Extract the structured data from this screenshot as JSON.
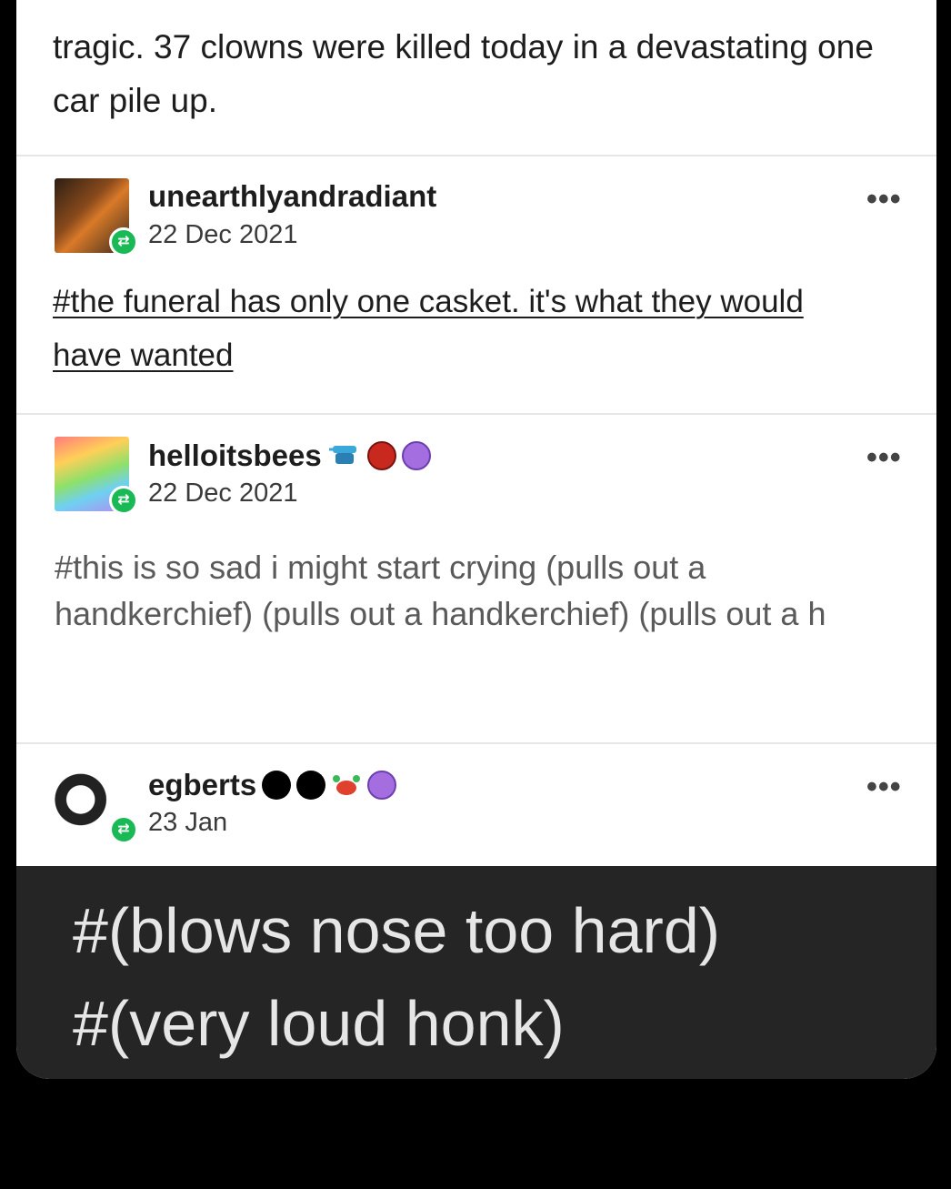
{
  "post_body": {
    "text": "tragic. 37 clowns were killed today in a devastating one car pile up."
  },
  "reblogs": [
    {
      "username": "unearthlyandradiant",
      "date": "22 Dec 2021",
      "tag_link": "#the funeral has only one casket. it's what they would have wanted",
      "badges": []
    },
    {
      "username": "helloitsbees",
      "date": "22 Dec 2021",
      "tags": "#this is so sad i might start crying (pulls out a handkerchief) (pulls out a handkerchief) (pulls out a h",
      "badges": [
        "wind-up-toy-badge-icon",
        "red-hexagon-badge-icon",
        "purple-paw-badge-icon"
      ]
    },
    {
      "username": "egberts",
      "date": "23 Jan",
      "tags_large": [
        "#(blows nose too hard)",
        "#(very loud honk)"
      ],
      "badges": [
        "black-dot-icon",
        "black-dot-icon",
        "crab-badge-icon",
        "purple-paw-badge-icon"
      ]
    }
  ],
  "icons": {
    "more": "•••",
    "reblog": "⇄"
  },
  "colors": {
    "reblog_green": "#19b955",
    "dark_panel": "#252525",
    "badge_purple": "#a46ee0",
    "badge_red": "#c8281e"
  }
}
